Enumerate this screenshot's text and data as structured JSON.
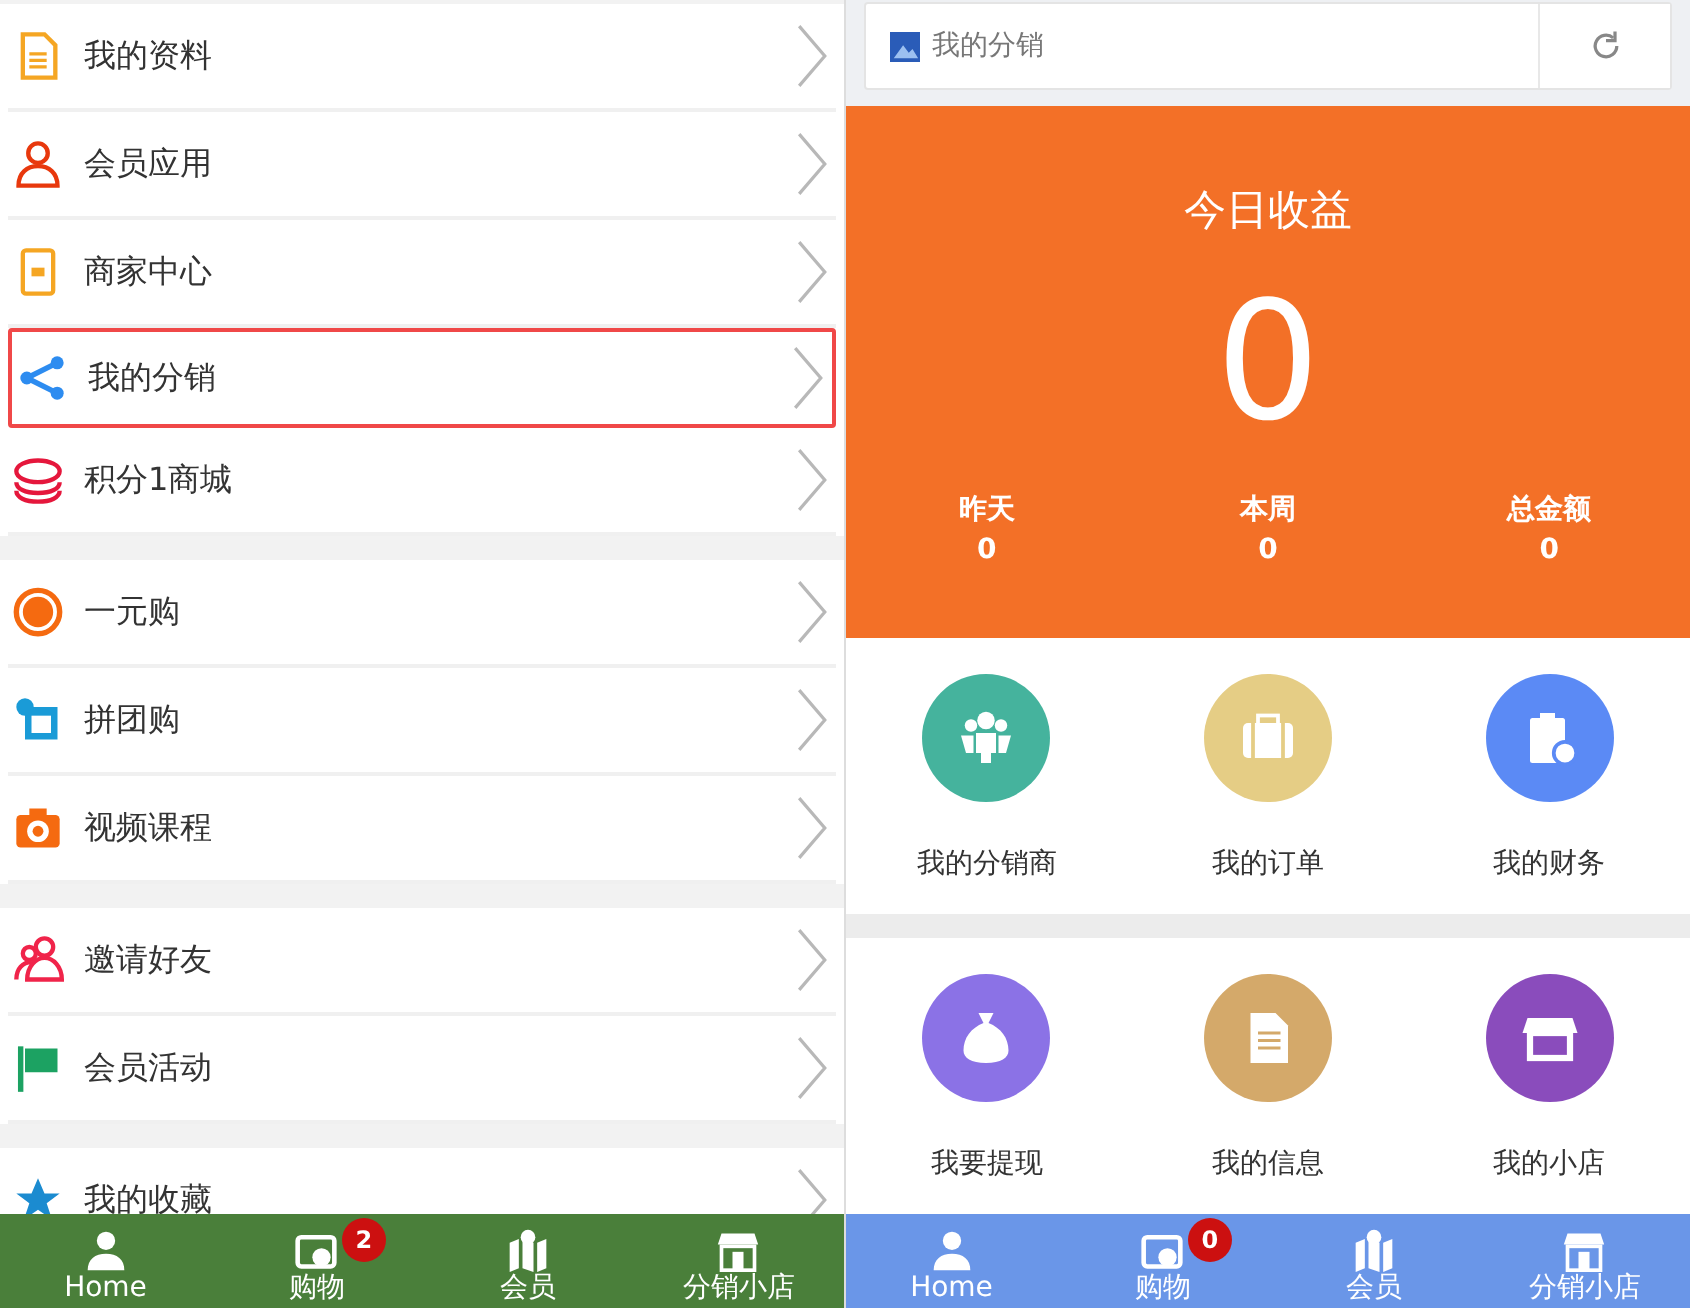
{
  "left": {
    "menu_groups": [
      {
        "items": [
          {
            "label": "我的资料",
            "selected": false
          },
          {
            "label": "会员应用",
            "selected": false
          },
          {
            "label": "商家中心",
            "selected": false
          },
          {
            "label": "我的分销",
            "selected": true
          },
          {
            "label": "积分1商城",
            "selected": false
          }
        ]
      },
      {
        "items": [
          {
            "label": "一元购",
            "selected": false
          },
          {
            "label": "拼团购",
            "selected": false
          },
          {
            "label": "视频课程",
            "selected": false
          }
        ]
      },
      {
        "items": [
          {
            "label": "邀请好友",
            "selected": false
          },
          {
            "label": "会员活动",
            "selected": false
          }
        ]
      },
      {
        "items": [
          {
            "label": "我的收藏",
            "selected": false
          }
        ]
      }
    ],
    "tab_bar": [
      {
        "label": "Home"
      },
      {
        "label": "购物",
        "badge": "2"
      },
      {
        "label": "会员"
      },
      {
        "label": "分销小店"
      }
    ]
  },
  "right": {
    "header": {
      "title": "我的分销"
    },
    "earnings": {
      "title": "今日收益",
      "value": "0",
      "stats": [
        {
          "label": "昨天",
          "value": "0"
        },
        {
          "label": "本周",
          "value": "0"
        },
        {
          "label": "总金额",
          "value": "0"
        }
      ]
    },
    "grids": [
      {
        "items": [
          {
            "label": "我的分销商",
            "color": "#45b39d"
          },
          {
            "label": "我的订单",
            "color": "#e5cd85"
          },
          {
            "label": "我的财务",
            "color": "#5b8af5"
          }
        ]
      },
      {
        "items": [
          {
            "label": "我要提现",
            "color": "#8b72e6"
          },
          {
            "label": "我的信息",
            "color": "#d4a96a"
          },
          {
            "label": "我的小店",
            "color": "#8a4cbc"
          }
        ]
      }
    ],
    "tab_bar": [
      {
        "label": "Home"
      },
      {
        "label": "购物",
        "badge": "0"
      },
      {
        "label": "会员"
      },
      {
        "label": "分销小店"
      }
    ]
  }
}
